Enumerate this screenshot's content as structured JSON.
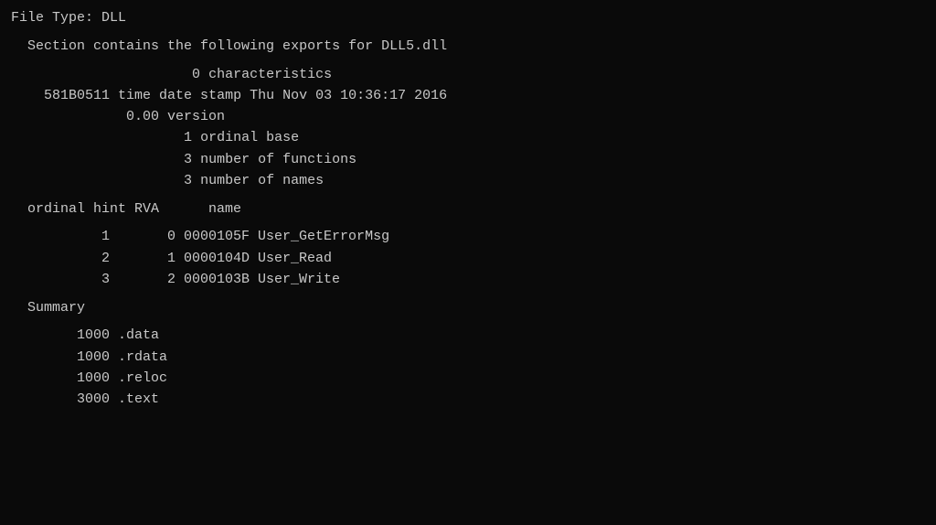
{
  "terminal": {
    "file_type_line": "File Type: DLL",
    "section_header": "Section contains the following exports for DLL5.dll",
    "characteristics_value": "          0",
    "characteristics_label": "characteristics",
    "timestamp_value": "581B0511",
    "timestamp_label": "time date stamp Thu Nov 03 10:36:17 2016",
    "version_value": "     0.00",
    "version_label": "version",
    "ordinal_base_value": "        1",
    "ordinal_base_label": "ordinal base",
    "num_functions_value": "        3",
    "num_functions_label": "number of functions",
    "num_names_value": "        3",
    "num_names_label": "number of names",
    "exports_header": "  ordinal hint RVA      name",
    "exports": [
      {
        "ordinal": "1",
        "hint": "0",
        "rva": "0000105F",
        "name": "User_GetErrorMsg"
      },
      {
        "ordinal": "2",
        "hint": "1",
        "rva": "0000104D",
        "name": "User_Read"
      },
      {
        "ordinal": "3",
        "hint": "2",
        "rva": "0000103B",
        "name": "User_Write"
      }
    ],
    "summary_label": "Summary",
    "summary_sections": [
      {
        "size": "1000",
        "name": ".data"
      },
      {
        "size": "1000",
        "name": ".rdata"
      },
      {
        "size": "1000",
        "name": ".reloc"
      },
      {
        "size": "3000",
        "name": ".text"
      }
    ]
  }
}
